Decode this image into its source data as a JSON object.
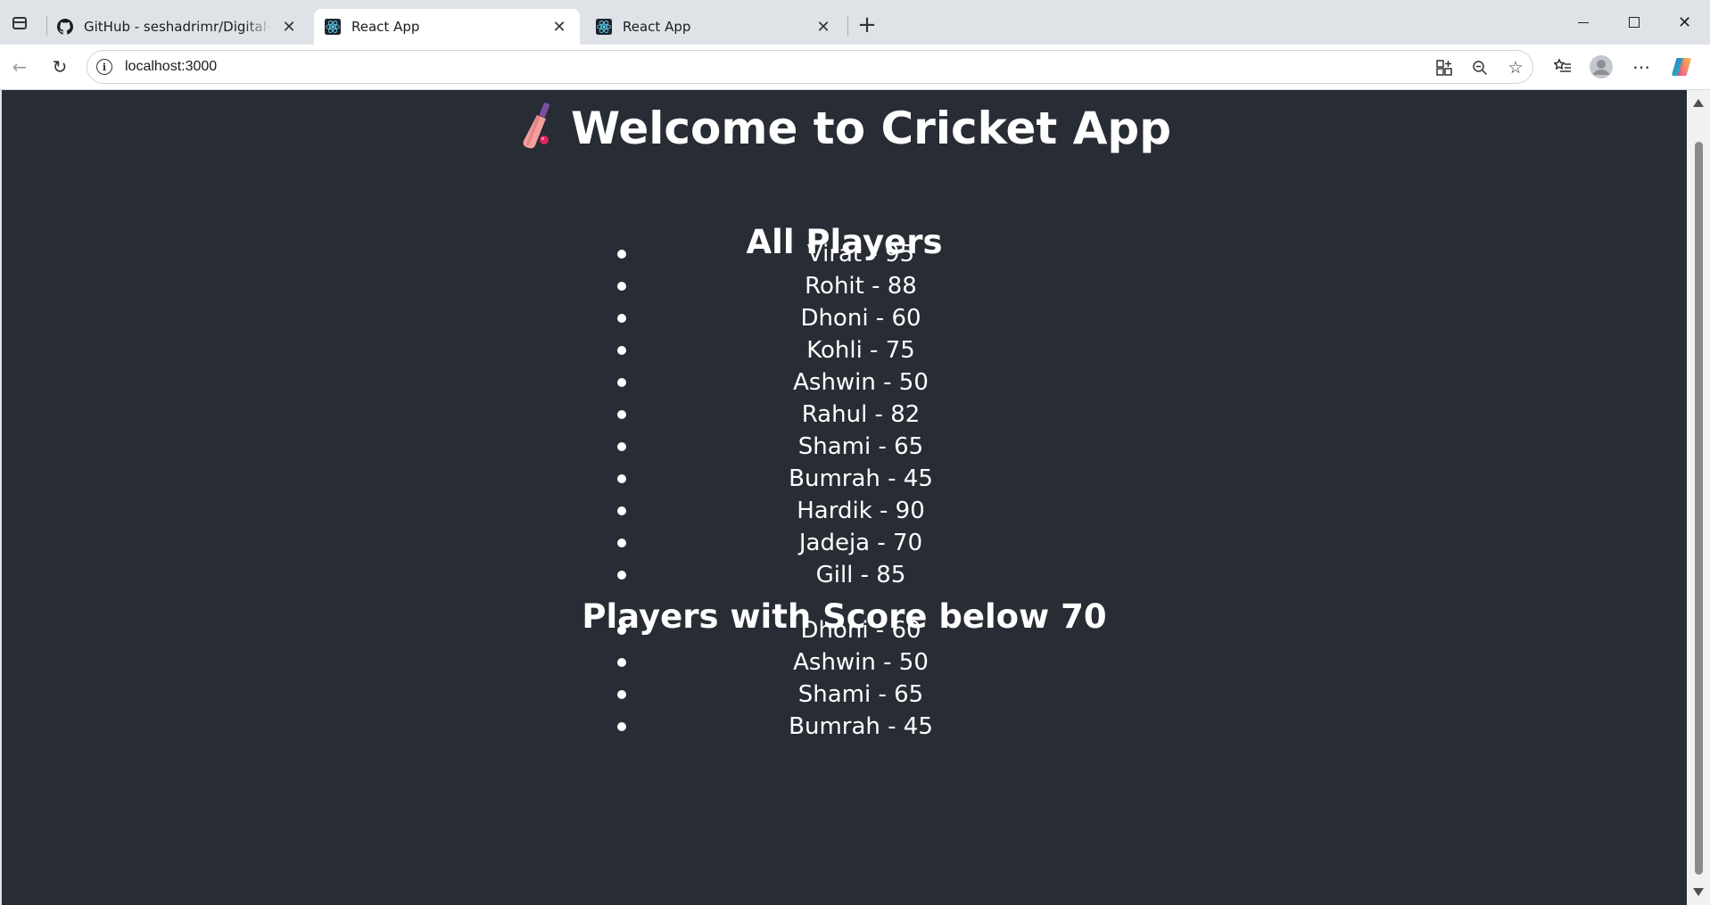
{
  "browser": {
    "tabs": [
      {
        "title": "GitHub - seshadrimr/Digital-Nurture",
        "favicon": "github-icon",
        "active": false
      },
      {
        "title": "React App",
        "favicon": "react-icon",
        "active": true
      },
      {
        "title": "React App",
        "favicon": "react-icon",
        "active": false
      }
    ],
    "url": "localhost:3000",
    "new_tab_symbol": "+",
    "colors": {
      "page_background": "#282c34",
      "text": "#ffffff",
      "chrome": "#dfe3e8"
    }
  },
  "page": {
    "title": "Welcome to Cricket App",
    "title_icon": "cricket-bat-icon",
    "all_players_heading": "All Players",
    "all_players": [
      "Virat - 95",
      "Rohit - 88",
      "Dhoni - 60",
      "Kohli - 75",
      "Ashwin - 50",
      "Rahul - 82",
      "Shami - 65",
      "Bumrah - 45",
      "Hardik - 90",
      "Jadeja - 70",
      "Gill - 85"
    ],
    "below_70_heading": "Players with Score below 70",
    "below_70_players": [
      "Dhoni - 60",
      "Ashwin - 50",
      "Shami - 65",
      "Bumrah - 45"
    ]
  }
}
